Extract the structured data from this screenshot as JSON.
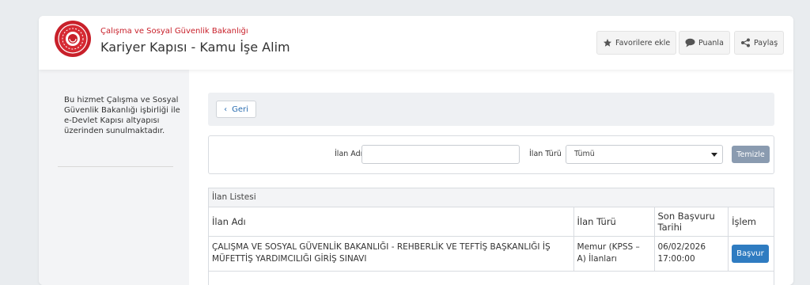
{
  "header": {
    "ministry": "Çalışma ve Sosyal Güvenlik Bakanlığı",
    "title": "Kariyer Kapısı - Kamu İşe Alim",
    "actions": [
      {
        "label": "Favorilere ekle",
        "icon": "star-icon"
      },
      {
        "label": "Puanla",
        "icon": "speech-bubble-icon"
      },
      {
        "label": "Paylaş",
        "icon": "share-icon"
      }
    ]
  },
  "sidebar": {
    "info": "Bu hizmet Çalışma ve Sosyal Güvenlik Bakanlığı işbirliği ile e-Devlet Kapısı altyapısı üzerinden sunulmaktadır."
  },
  "main": {
    "back_label": "Geri",
    "filters": {
      "name_label": "İlan Adı",
      "name_value": "",
      "type_label": "İlan Türü",
      "type_selected": "Tümü",
      "clear_label": "Temizle"
    },
    "list": {
      "title": "İlan Listesi",
      "columns": [
        "İlan Adı",
        "İlan Türü",
        "Son Başvuru Tarihi",
        "İşlem"
      ],
      "rows": [
        {
          "name": "ÇALIŞMA VE SOSYAL GÜVENLİK BAKANLIĞI - REHBERLİK VE TEFTİŞ BAŞKANLIĞI İŞ MÜFETTİŞ YARDIMCILIĞI GİRİŞ SINAVI",
          "type": "Memur (KPSS – A) İlanları",
          "deadline": "06/02/2026 17:00:00",
          "action": "Başvur"
        }
      ]
    }
  },
  "colors": {
    "brand_red": "#c8202a",
    "link_blue": "#2a6db0",
    "primary_button": "#2f7cc1",
    "clear_button": "#8a9bb0"
  }
}
